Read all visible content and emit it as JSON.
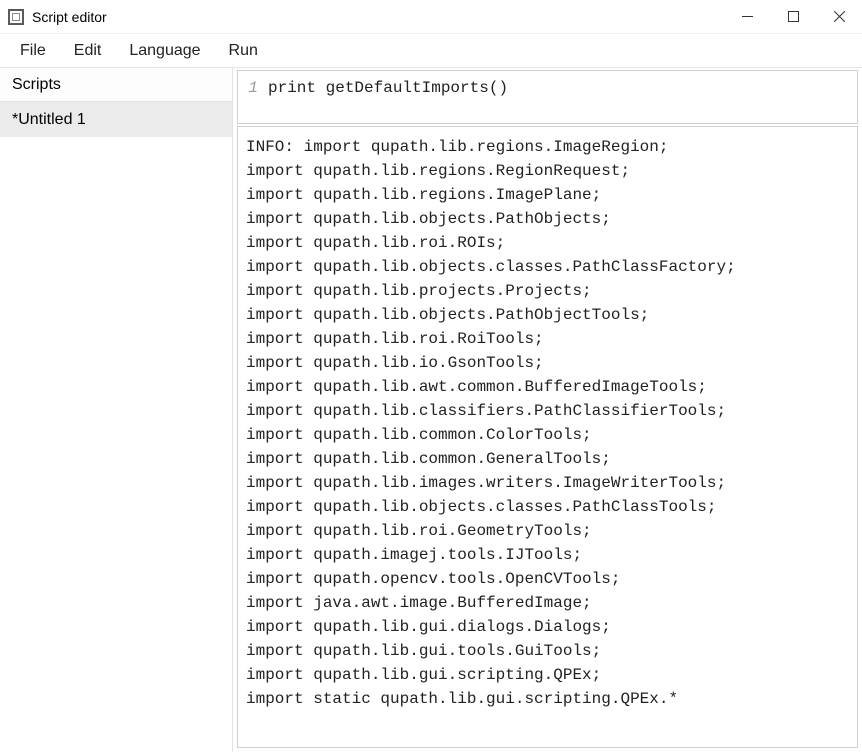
{
  "window": {
    "title": "Script editor"
  },
  "menu": {
    "file": "File",
    "edit": "Edit",
    "language": "Language",
    "run": "Run"
  },
  "sidebar": {
    "header": "Scripts",
    "items": [
      "*Untitled 1"
    ]
  },
  "editor": {
    "gutter": [
      "1"
    ],
    "code": "print getDefaultImports()"
  },
  "output": "INFO: import qupath.lib.regions.ImageRegion;\nimport qupath.lib.regions.RegionRequest;\nimport qupath.lib.regions.ImagePlane;\nimport qupath.lib.objects.PathObjects;\nimport qupath.lib.roi.ROIs;\nimport qupath.lib.objects.classes.PathClassFactory;\nimport qupath.lib.projects.Projects;\nimport qupath.lib.objects.PathObjectTools;\nimport qupath.lib.roi.RoiTools;\nimport qupath.lib.io.GsonTools;\nimport qupath.lib.awt.common.BufferedImageTools;\nimport qupath.lib.classifiers.PathClassifierTools;\nimport qupath.lib.common.ColorTools;\nimport qupath.lib.common.GeneralTools;\nimport qupath.lib.images.writers.ImageWriterTools;\nimport qupath.lib.objects.classes.PathClassTools;\nimport qupath.lib.roi.GeometryTools;\nimport qupath.imagej.tools.IJTools;\nimport qupath.opencv.tools.OpenCVTools;\nimport java.awt.image.BufferedImage;\nimport qupath.lib.gui.dialogs.Dialogs;\nimport qupath.lib.gui.tools.GuiTools;\nimport qupath.lib.gui.scripting.QPEx;\nimport static qupath.lib.gui.scripting.QPEx.*"
}
